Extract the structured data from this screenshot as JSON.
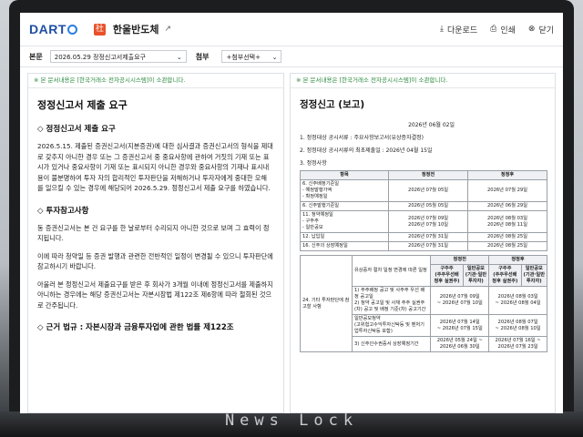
{
  "app": {
    "logo": "DART",
    "company": "한울반도체"
  },
  "toolbar": {
    "download": "다운로드",
    "print": "인쇄",
    "close": "닫기"
  },
  "selectors": {
    "main_label": "본문",
    "main_value": "2026.05.29  정정신고서제출요구",
    "attach_label": "첨부",
    "attach_value": "+첨부선택+"
  },
  "left": {
    "notice": "※ 본 문서내용은 [한국거래소 전자공시시스템]이 소관합니다.",
    "title": "정정신고서 제출 요구",
    "sec1": "◇ 정정신고서 제출 요구",
    "para1": "2026.5.15. 제출된 증권신고서(지분증권)에 대한 심사결과 증권신고서의 형식을 제대로 갖추지 아니한 경우 또는 그 증권신고서 중 중요사항에 관하여 거짓의 기재 또는 표시가 있거나 중요사항이 기재 또는 표시되지 아니한 경우와 중요사항의 기재나 표시내용이 불분명하여 투자 자의 합리적인 투자판단을 저해하거나 투자자에게 중대한 오해 를 일으킬 수 있는 경우에 해당되어 2026.5.29. 정정신고서 제출 요구를 하였습니다.",
    "sec2": "◇ 투자참고사항",
    "para2": "동 증권신고서는 본 건 요구를 한 날로부터 수리되지 아니한 것으로 보며 그 효력이 정지됩니다.",
    "para3": "이에 따라 청약일 등 증권 발행과 관련한 전반적인 일정이 변경될 수 있으니 투자판단에 참고하시기 바랍니다.",
    "para4": "아울러 본 정정신고서 제출요구를 받은 후 회사가 3개월 이내에 정정신고서를 제출하지 아니하는 경우에는 해당 증권신고서는 자본시장법 제122조 제6항에 따라 철회된 것으로 간주됩니다.",
    "sec3": "◇ 근거 법규 : 자본시장과 금융투자업에 관한 법률 제122조"
  },
  "right": {
    "notice": "※ 본 문서내용은 [한국거래소 전자공시시스템]이 소관합니다.",
    "title": "정정신고 (보고)",
    "date": "2026년 06월 02일",
    "item1": "1. 정정대상 공시서류 : 주요사항보고서(유상증자결정)",
    "item2": "2. 정정대상 공시서류의 최초제출일 : 2026년 04월 15일",
    "item3": "3. 정정사항",
    "table1": {
      "headers": [
        "항목",
        "정정전",
        "정정후"
      ],
      "rows": [
        [
          "6. 신주배정기준일\n- 예정발행가액\n- 확정예정일",
          "2026년 07월 05일",
          "2026년 07월 29일"
        ],
        [
          "6. 신주발행기준일",
          "2026년 05월 05일",
          "2026년 06월 29일"
        ],
        [
          "11. 청약예정일\n- 구주주\n- 일반공모",
          "2026년 07월 09일\n2026년 07월 10일",
          "2026년 08월 03일\n2026년 08월 11일"
        ],
        [
          "12. 납입일",
          "2026년 07월 31일",
          "2026년 08월 25일"
        ],
        [
          "16. 신주의 상장예정일",
          "2026년 07월 31일",
          "2026년 08월 25일"
        ]
      ]
    },
    "table2": {
      "row_label": "24. 기타 투자판단에 참고할 사항",
      "sub_label": "유상증자 절차 일정 변경에 따른 일정",
      "col_before": "정정전",
      "col_after": "정정후",
      "h1": "구주주\n(주주우선배정후 실권주)",
      "h2": "일반공모\n(기관·일반투자자)",
      "step1": "1) 주주배정 공고 및 사주주 우선 배정 공고일\n2) 청약 공고일 및 사채 주주 실권주(차) 공고 및 배정 기준(차) 공고기간",
      "v1a": "2026년 07월 09일\n~ 2026년 07월 10일",
      "v1b": "2026년 08월 03일\n~ 2026년 08월 04일",
      "sub2": "일반공모청약\n(고위험고수익투자신탁등 및 벤처기업투자신탁등 포함)",
      "v2a": "2026년 07월 14일\n~ 2026년 07월 15일",
      "v2b": "2026년 08월 07일\n~ 2026년 08월 10일",
      "step3": "3) 신주인수권증서 상장예정기간",
      "v3a": "2026년 05월 24일 ~ 2026년 06월 30일",
      "v3b": "2026년 07월 16일 ~ 2026년 07월 23일"
    }
  },
  "watermark": "News Lock"
}
